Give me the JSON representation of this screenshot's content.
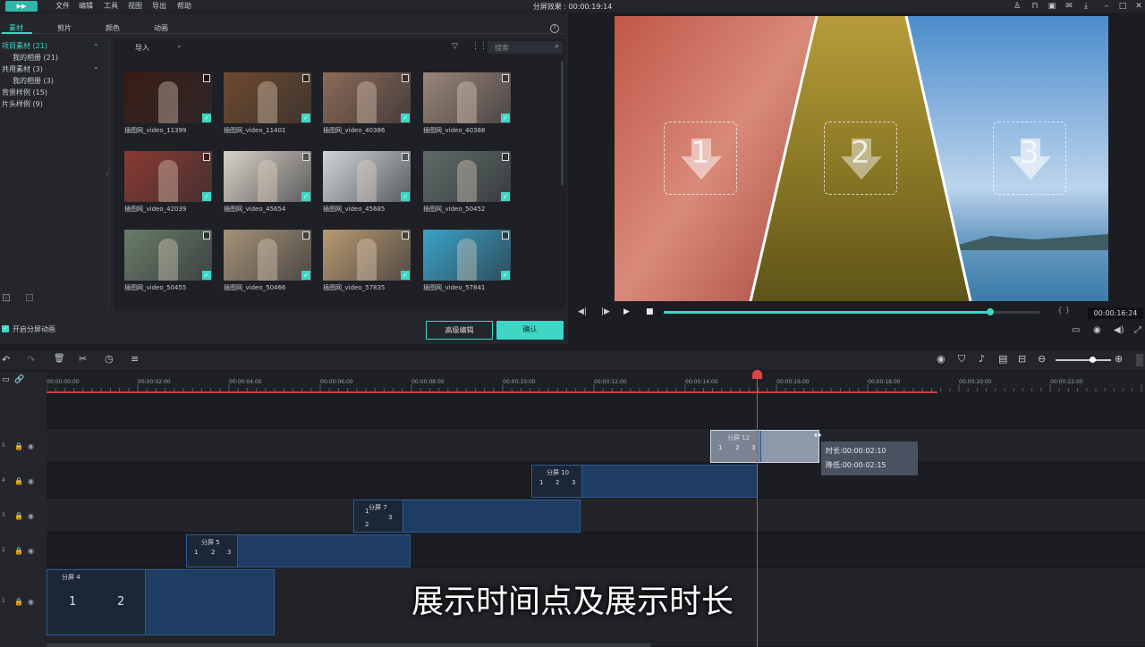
{
  "titlebar": {
    "menu": [
      "文件",
      "编辑",
      "工具",
      "视图",
      "导出",
      "帮助"
    ],
    "title": "分屏效果 : 00:00:19:14"
  },
  "left_panel": {
    "tabs": [
      "素材",
      "剪片",
      "颜色",
      "动画"
    ],
    "active_tab": "素材",
    "tree": [
      {
        "label": "项目素材 (21)",
        "indent": 0
      },
      {
        "label": "我的相册 (21)",
        "indent": 1
      },
      {
        "label": "共用素材 (3)",
        "indent": 0
      },
      {
        "label": "我的相册 (3)",
        "indent": 1
      },
      {
        "label": "背景样例 (15)",
        "indent": 0
      },
      {
        "label": "片头样例 (9)",
        "indent": 0
      }
    ],
    "import_label": "导入",
    "search_placeholder": "搜索",
    "thumbnails": [
      {
        "label": "插图网_video_11399",
        "color": "#3a1c14"
      },
      {
        "label": "插图网_video_11401",
        "color": "#6e4a2e"
      },
      {
        "label": "插图网_video_40386",
        "color": "#8b6a58"
      },
      {
        "label": "插图网_video_40388",
        "color": "#9a8678"
      },
      {
        "label": "插图网_video_42039",
        "color": "#8a3a32"
      },
      {
        "label": "插图网_video_45654",
        "color": "#d8d2c8"
      },
      {
        "label": "插图网_video_45685",
        "color": "#cfd6d8"
      },
      {
        "label": "插图网_video_50452",
        "color": "#5e6a66"
      },
      {
        "label": "插图网_video_50455",
        "color": "#6a7c6a"
      },
      {
        "label": "插图网_video_50466",
        "color": "#a49278"
      },
      {
        "label": "插图网_video_57835",
        "color": "#b89a72"
      },
      {
        "label": "插图网_video_57841",
        "color": "#3aa2c8"
      }
    ],
    "split_anim_label": "开启分屏动画",
    "advanced_edit_label": "高级编辑",
    "confirm_label": "确认"
  },
  "preview": {
    "numbers": [
      "1",
      "2",
      "3"
    ],
    "timecode": "00:00:16:24",
    "progress": 0.87,
    "brackets": "{ }"
  },
  "timeline": {
    "ruler": [
      "00:00:00:00",
      "00:00:02:00",
      "00:00:04:00",
      "00:00:06:00",
      "00:00:08:00",
      "00:00:10:00",
      "00:00:12:00",
      "00:00:14:00",
      "00:00:16:00",
      "00:00:18:00",
      "00:00:20:00",
      "00:00:22:00"
    ],
    "tracks": [
      "5",
      "4",
      "3",
      "2",
      "1"
    ],
    "clips": [
      {
        "title": "分屏 12",
        "cells": [
          "1",
          "2",
          "3"
        ]
      },
      {
        "title": "分屏 10",
        "cells": [
          "1",
          "2",
          "3"
        ]
      },
      {
        "title": "分屏 7",
        "cells": [
          "1",
          "2",
          "3"
        ]
      },
      {
        "title": "分屏 5",
        "cells": [
          "1",
          "2",
          "3"
        ]
      },
      {
        "title": "分屏 4",
        "cells": [
          "1",
          "2"
        ]
      }
    ],
    "tooltip": {
      "duration": "时长:00:00:02:10",
      "rate": "降低:00:00:02:15"
    }
  },
  "subtitle": "展示时间点及展示时长",
  "colors": {
    "accent": "#3fd6c5",
    "clip": "#1f3d63",
    "playhead": "#e04444"
  }
}
